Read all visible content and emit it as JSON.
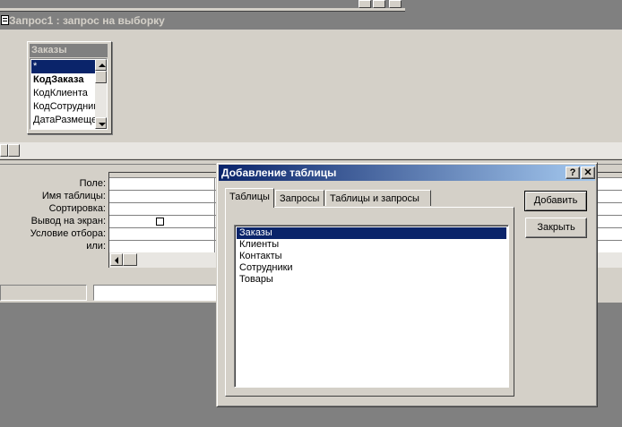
{
  "background_window": {
    "title": "Запрос1 : запрос на выборку"
  },
  "table_box": {
    "title": "Заказы",
    "fields": [
      "*",
      "КодЗаказа",
      "КодКлиента",
      "КодСотрудника",
      "ДатаРазмещения"
    ]
  },
  "grid": {
    "row_labels": [
      "Поле:",
      "Имя таблицы:",
      "Сортировка:",
      "Вывод на экран:",
      "Условие отбора:",
      "или:"
    ]
  },
  "dialog": {
    "title": "Добавление таблицы",
    "help_label": "?",
    "close_label": "✕",
    "tabs": [
      {
        "label": "Таблицы",
        "selected": true
      },
      {
        "label": "Запросы",
        "selected": false
      },
      {
        "label": "Таблицы и запросы",
        "selected": false
      }
    ],
    "tables": [
      {
        "label": "Заказы",
        "selected": true
      },
      {
        "label": "Клиенты",
        "selected": false
      },
      {
        "label": "Контакты",
        "selected": false
      },
      {
        "label": "Сотрудники",
        "selected": false
      },
      {
        "label": "Товары",
        "selected": false
      }
    ],
    "add_label": "Добавить",
    "close_button_label": "Закрыть"
  },
  "colors": {
    "face": "#d4d0c8",
    "active_title_start": "#0a246a",
    "active_title_end": "#a6caf0",
    "inactive_title": "#808080",
    "selection": "#0a246a"
  }
}
